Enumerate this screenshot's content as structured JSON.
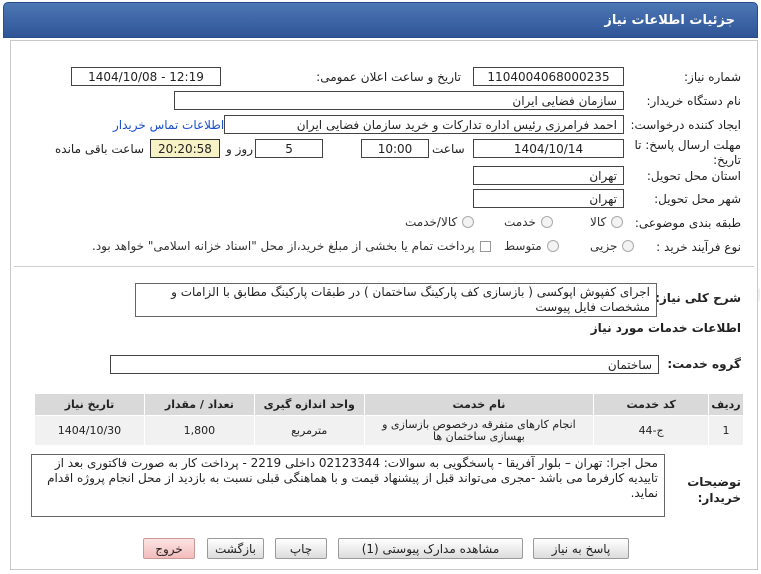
{
  "header": {
    "title": "جزئیات اطلاعات نیاز"
  },
  "fields": {
    "need_number_label": "شماره نیاز:",
    "need_number": "1104004068000235",
    "announce_label": "تاریخ و ساعت اعلان عمومی:",
    "announce_value": "1404/10/08 - 12:19",
    "buyer_org_label": "نام دستگاه خریدار:",
    "buyer_org": "سازمان فضایی ایران",
    "creator_label": "ایجاد کننده درخواست:",
    "creator": "احمد فرامرزی رئیس اداره تدارکات و خرید سازمان فضایی ایران",
    "contact_link": "اطلاعات تماس خریدار",
    "deadline_label": "مهلت ارسال پاسخ: تا تاریخ:",
    "deadline_date": "1404/10/14",
    "time_label": "ساعت",
    "deadline_time": "10:00",
    "days": "5",
    "days_label": "روز و",
    "remaining_time": "20:20:58",
    "remaining_label": "ساعت باقی مانده",
    "province_label": "استان محل تحویل:",
    "province": "تهران",
    "city_label": "شهر محل تحویل:",
    "city": "تهران",
    "category_label": "طبقه بندی موضوعی:",
    "category_options": [
      "کالا",
      "خدمت",
      "کالا/خدمت"
    ],
    "process_label": "نوع فرآیند خرید :",
    "process_options": [
      "جزیی",
      "متوسط"
    ],
    "process_note": "پرداخت تمام یا بخشی از مبلغ خرید،از محل \"اسناد خزانه اسلامی\" خواهد بود."
  },
  "summary": {
    "label": "شرح کلی نیاز:",
    "text": "اجرای کفپوش اپوکسی ( بازسازی کف پارکینگ ساختمان ) در طبقات پارکینگ مطابق با الزامات و مشخصات فایل پیوست"
  },
  "services": {
    "section_title": "اطلاعات خدمات مورد نیاز",
    "group_label": "گروه خدمت:",
    "group_value": "ساختمان",
    "columns": [
      "ردیف",
      "کد خدمت",
      "نام خدمت",
      "واحد اندازه گیری",
      "تعداد / مقدار",
      "تاریخ نیاز"
    ],
    "rows": [
      {
        "row": "1",
        "code": "ج-44",
        "name": "انجام کارهای متفرقه درخصوص بازسازی و بهسازی ساختمان ها",
        "unit": "مترمربع",
        "qty": "1,800",
        "date": "1404/10/30"
      }
    ]
  },
  "buyer_notes": {
    "label": "توضیحات خریدار:",
    "text": "محل اجرا: تهران – بلوار آفریقا - پاسخگویی به سوالات: 02123344 داخلی 2219 - پرداخت کار به صورت فاکتوری بعد از تاییدیه کارفرما می باشد -مجری می‌تواند قبل از پیشنهاد قیمت و با هماهنگی قبلی نسبت به بازدید از محل انجام پروژه اقدام نماید."
  },
  "buttons": {
    "reply": "پاسخ به نیاز",
    "docs": "مشاهده مدارک پیوستی (1)",
    "print": "چاپ",
    "back": "بازگشت",
    "exit": "خروج"
  },
  "watermark": {
    "text": "AriaTender.net"
  },
  "colors": {
    "header": "#3b64a8",
    "link": "#1a4fcf",
    "remaining_bg": "#f6f2c5",
    "exit_bg": "#f6caca"
  }
}
